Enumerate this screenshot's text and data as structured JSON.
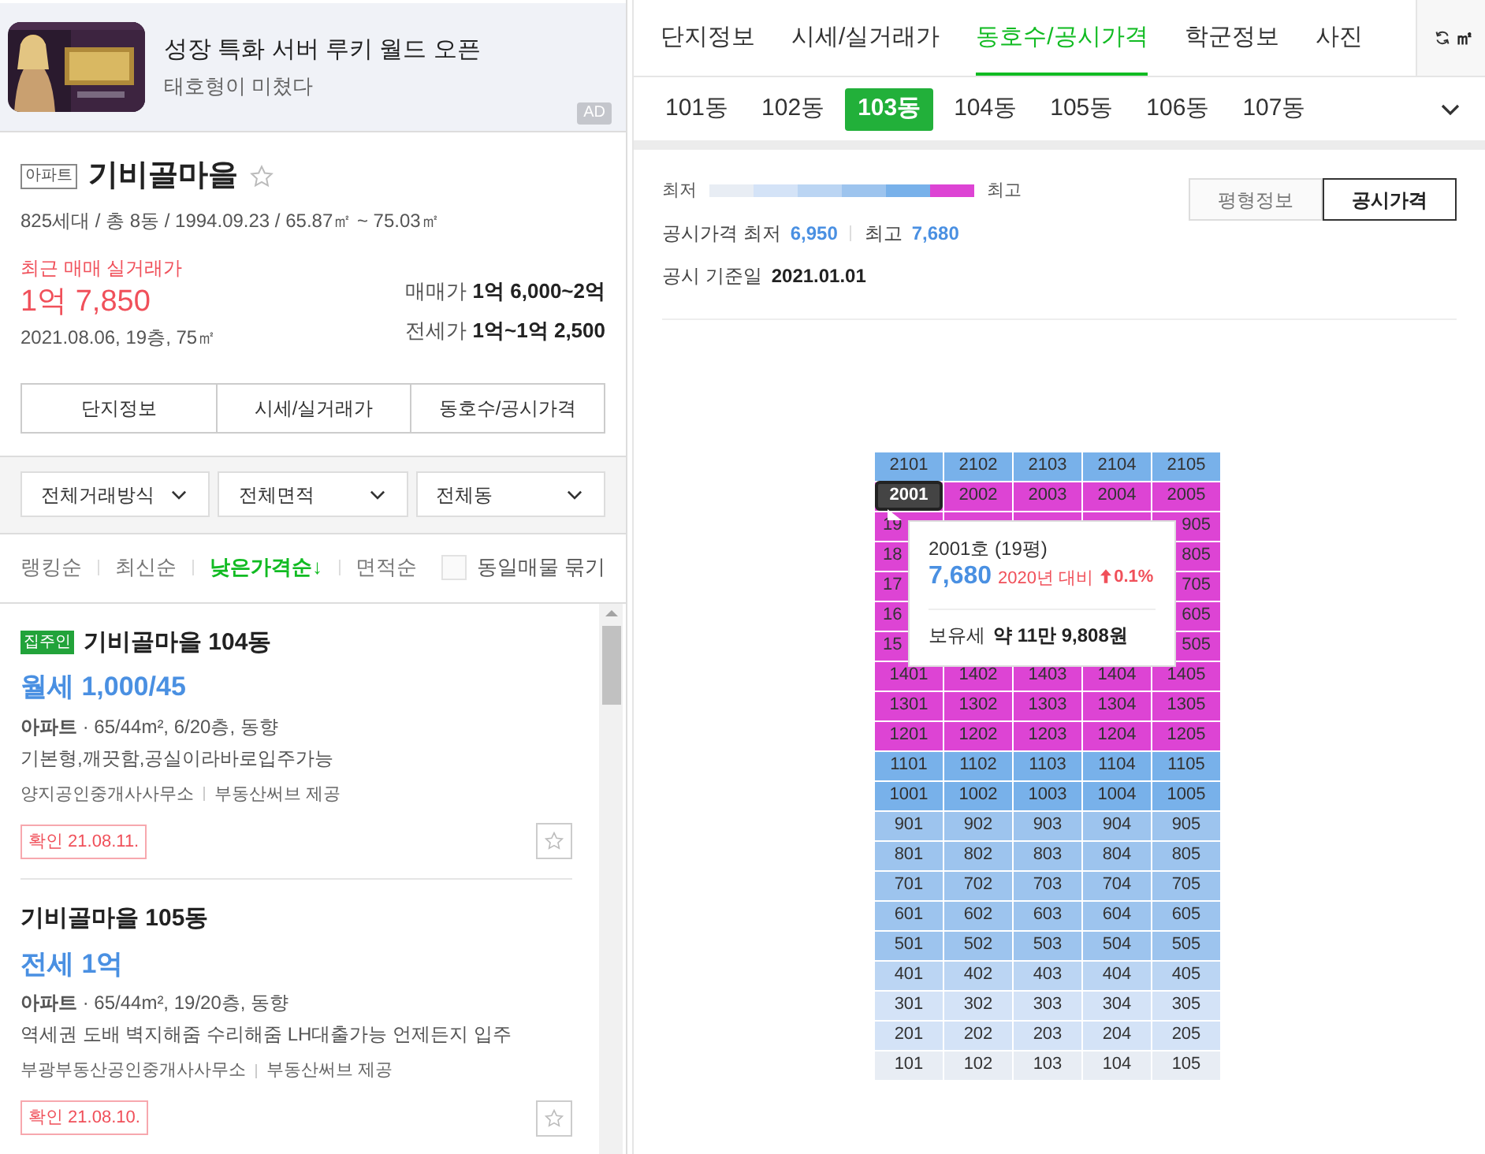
{
  "ad": {
    "title": "성장 특화 서버 루키 월드 오픈",
    "subtitle": "태호형이 미쳤다",
    "badge": "AD"
  },
  "complex": {
    "type_tag": "아파트",
    "name": "기비골마을",
    "favorite": false,
    "summary": "825세대 / 총 8동 / 1994.09.23 / 65.87㎡ ~ 75.03㎡",
    "recent_label": "최근 매매 실거래가",
    "recent_price": "1억 7,850",
    "recent_detail": "2021.08.06, 19층, 75㎡",
    "prices": [
      {
        "label": "매매가",
        "value": "1억 6,000~2억"
      },
      {
        "label": "전세가",
        "value": "1억~1억 2,500"
      }
    ],
    "buttons": [
      "단지정보",
      "시세/실거래가",
      "동호수/공시가격"
    ]
  },
  "filters": [
    "전체거래방식",
    "전체면적",
    "전체동"
  ],
  "sort_options": [
    {
      "label": "랭킹순",
      "selected": false
    },
    {
      "label": "최신순",
      "selected": false
    },
    {
      "label": "낮은가격순↓",
      "selected": true
    },
    {
      "label": "면적순",
      "selected": false
    }
  ],
  "group_same": {
    "label": "동일매물 묶기",
    "checked": false
  },
  "listings": [
    {
      "badge": "집주인",
      "title": "기비골마을 104동",
      "price": "월세 1,000/45",
      "spec": "**아파트** · 65/44m², 6/20층, 동향",
      "description": "기본형,깨끗함,공실이라바로입주가능",
      "agent": "양지공인중개사사무소",
      "provider": "부동산써브 제공",
      "confirmed": "확인 21.08.11.",
      "favorite": false
    },
    {
      "title": "기비골마을 105동",
      "price": "전세 1억",
      "spec": "**아파트** · 65/44m², 19/20층, 동향",
      "description": "역세권 도배 벽지해줌 수리해줌 LH대출가능 언제든지 입주",
      "agent": "부광부동산공인중개사사무소",
      "provider": "부동산써브 제공",
      "confirmed": "확인 21.08.10.",
      "favorite": false
    }
  ],
  "tabs": [
    {
      "label": "단지정보",
      "selected": false
    },
    {
      "label": "시세/실거래가",
      "selected": false
    },
    {
      "label": "동호수/공시가격",
      "selected": true
    },
    {
      "label": "학군정보",
      "selected": false
    },
    {
      "label": "사진",
      "selected": false
    }
  ],
  "unit_toggle": "㎡",
  "buildings": [
    {
      "label": "101동",
      "selected": false
    },
    {
      "label": "102동",
      "selected": false
    },
    {
      "label": "103동",
      "selected": true
    },
    {
      "label": "104동",
      "selected": false
    },
    {
      "label": "105동",
      "selected": false
    },
    {
      "label": "106동",
      "selected": false
    },
    {
      "label": "107동",
      "selected": false
    }
  ],
  "legend": {
    "low": "최저",
    "high": "최고",
    "steps": [
      {
        "color": "#e8edf4"
      },
      {
        "color": "#d4e3f7"
      },
      {
        "color": "#bbd5f3"
      },
      {
        "color": "#9dc4ee"
      },
      {
        "color": "#78b1ea"
      },
      {
        "color": "#dd44d4"
      }
    ]
  },
  "view_toggle": [
    {
      "label": "평형정보",
      "selected": false
    },
    {
      "label": "공시가격",
      "selected": true
    }
  ],
  "price_range": {
    "label": "공시가격 최저",
    "low": "6,950",
    "high_label": "최고",
    "high": "7,680"
  },
  "basis": {
    "label": "공시 기준일",
    "value": "2021.01.01"
  },
  "grid": {
    "rows": [
      {
        "color": "#78b1ea",
        "cells": [
          {
            "label": "2101",
            "selected": false
          },
          {
            "label": "2102",
            "selected": false
          },
          {
            "label": "2103",
            "selected": false
          },
          {
            "label": "2104",
            "selected": false
          },
          {
            "label": "2105",
            "selected": false
          }
        ]
      },
      {
        "color": "#dd44d4",
        "cells": [
          {
            "label": "2001",
            "selected": true
          },
          {
            "label": "2002",
            "selected": false
          },
          {
            "label": "2003",
            "selected": false
          },
          {
            "label": "2004",
            "selected": false
          },
          {
            "label": "2005",
            "selected": false
          }
        ]
      },
      {
        "color": "#dd44d4",
        "kind": "partial",
        "cells": [
          {
            "label": "19",
            "selected": false
          },
          {
            "label": "905",
            "selected": false
          }
        ]
      },
      {
        "color": "#dd44d4",
        "kind": "partial",
        "cells": [
          {
            "label": "18",
            "selected": false
          },
          {
            "label": "805",
            "selected": false
          }
        ]
      },
      {
        "color": "#dd44d4",
        "kind": "partial",
        "cells": [
          {
            "label": "17",
            "selected": false
          },
          {
            "label": "705",
            "selected": false
          }
        ]
      },
      {
        "color": "#dd44d4",
        "kind": "partial",
        "cells": [
          {
            "label": "16",
            "selected": false
          },
          {
            "label": "605",
            "selected": false
          }
        ]
      },
      {
        "color": "#dd44d4",
        "kind": "partial",
        "cells": [
          {
            "label": "15",
            "selected": false
          },
          {
            "label": "505",
            "selected": false
          }
        ]
      },
      {
        "color": "#dd44d4",
        "cells": [
          {
            "label": "1401",
            "selected": false
          },
          {
            "label": "1402",
            "selected": false
          },
          {
            "label": "1403",
            "selected": false
          },
          {
            "label": "1404",
            "selected": false
          },
          {
            "label": "1405",
            "selected": false
          }
        ]
      },
      {
        "color": "#dd44d4",
        "cells": [
          {
            "label": "1301",
            "selected": false
          },
          {
            "label": "1302",
            "selected": false
          },
          {
            "label": "1303",
            "selected": false
          },
          {
            "label": "1304",
            "selected": false
          },
          {
            "label": "1305",
            "selected": false
          }
        ]
      },
      {
        "color": "#dd44d4",
        "cells": [
          {
            "label": "1201",
            "selected": false
          },
          {
            "label": "1202",
            "selected": false
          },
          {
            "label": "1203",
            "selected": false
          },
          {
            "label": "1204",
            "selected": false
          },
          {
            "label": "1205",
            "selected": false
          }
        ]
      },
      {
        "color": "#78b1ea",
        "cells": [
          {
            "label": "1101",
            "selected": false
          },
          {
            "label": "1102",
            "selected": false
          },
          {
            "label": "1103",
            "selected": false
          },
          {
            "label": "1104",
            "selected": false
          },
          {
            "label": "1105",
            "selected": false
          }
        ]
      },
      {
        "color": "#78b1ea",
        "cells": [
          {
            "label": "1001",
            "selected": false
          },
          {
            "label": "1002",
            "selected": false
          },
          {
            "label": "1003",
            "selected": false
          },
          {
            "label": "1004",
            "selected": false
          },
          {
            "label": "1005",
            "selected": false
          }
        ]
      },
      {
        "color": "#9dc4ee",
        "cells": [
          {
            "label": "901",
            "selected": false
          },
          {
            "label": "902",
            "selected": false
          },
          {
            "label": "903",
            "selected": false
          },
          {
            "label": "904",
            "selected": false
          },
          {
            "label": "905",
            "selected": false
          }
        ]
      },
      {
        "color": "#9dc4ee",
        "cells": [
          {
            "label": "801",
            "selected": false
          },
          {
            "label": "802",
            "selected": false
          },
          {
            "label": "803",
            "selected": false
          },
          {
            "label": "804",
            "selected": false
          },
          {
            "label": "805",
            "selected": false
          }
        ]
      },
      {
        "color": "#9dc4ee",
        "cells": [
          {
            "label": "701",
            "selected": false
          },
          {
            "label": "702",
            "selected": false
          },
          {
            "label": "703",
            "selected": false
          },
          {
            "label": "704",
            "selected": false
          },
          {
            "label": "705",
            "selected": false
          }
        ]
      },
      {
        "color": "#9dc4ee",
        "cells": [
          {
            "label": "601",
            "selected": false
          },
          {
            "label": "602",
            "selected": false
          },
          {
            "label": "603",
            "selected": false
          },
          {
            "label": "604",
            "selected": false
          },
          {
            "label": "605",
            "selected": false
          }
        ]
      },
      {
        "color": "#9dc4ee",
        "cells": [
          {
            "label": "501",
            "selected": false
          },
          {
            "label": "502",
            "selected": false
          },
          {
            "label": "503",
            "selected": false
          },
          {
            "label": "504",
            "selected": false
          },
          {
            "label": "505",
            "selected": false
          }
        ]
      },
      {
        "color": "#bbd5f3",
        "cells": [
          {
            "label": "401",
            "selected": false
          },
          {
            "label": "402",
            "selected": false
          },
          {
            "label": "403",
            "selected": false
          },
          {
            "label": "404",
            "selected": false
          },
          {
            "label": "405",
            "selected": false
          }
        ]
      },
      {
        "color": "#d4e3f7",
        "cells": [
          {
            "label": "301",
            "selected": false
          },
          {
            "label": "302",
            "selected": false
          },
          {
            "label": "303",
            "selected": false
          },
          {
            "label": "304",
            "selected": false
          },
          {
            "label": "305",
            "selected": false
          }
        ]
      },
      {
        "color": "#d4e3f7",
        "cells": [
          {
            "label": "201",
            "selected": false
          },
          {
            "label": "202",
            "selected": false
          },
          {
            "label": "203",
            "selected": false
          },
          {
            "label": "204",
            "selected": false
          },
          {
            "label": "205",
            "selected": false
          }
        ]
      },
      {
        "color": "#e8edf4",
        "cells": [
          {
            "label": "101",
            "selected": false
          },
          {
            "label": "102",
            "selected": false
          },
          {
            "label": "103",
            "selected": false
          },
          {
            "label": "104",
            "selected": false
          },
          {
            "label": "105",
            "selected": false
          }
        ]
      }
    ]
  },
  "tooltip": {
    "unit": "2001호 (19평)",
    "price": "7,680",
    "change_label": "2020년 대비",
    "change": "0.1%",
    "tax_label": "보유세",
    "tax": "약 11만 9,808원"
  }
}
